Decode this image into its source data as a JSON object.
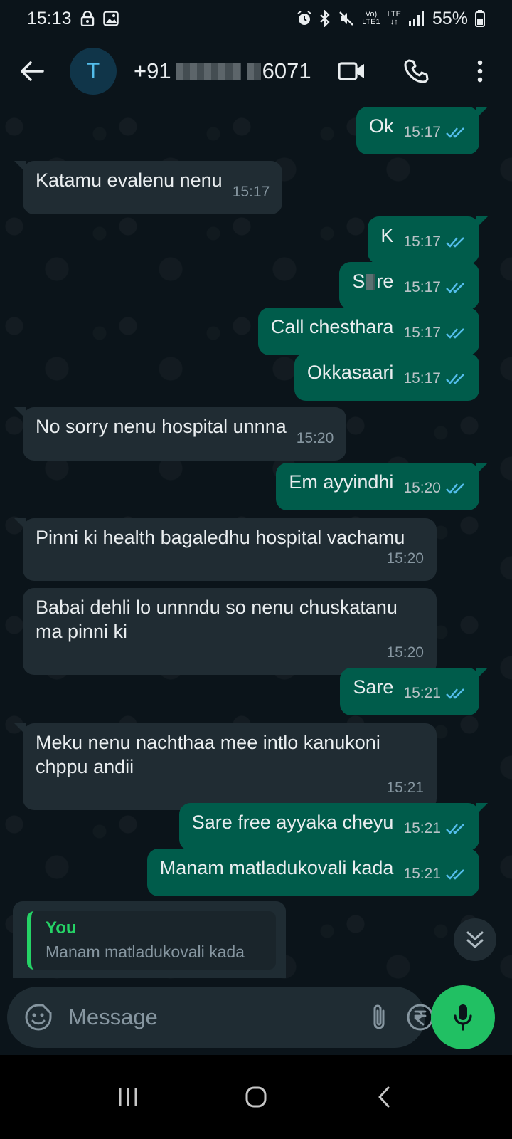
{
  "status_bar": {
    "time": "15:13",
    "network_top": "Vo)",
    "network_bottom": "LTE1",
    "lte_label": "LTE",
    "battery": "55%"
  },
  "header": {
    "avatar_letter": "T",
    "contact_prefix": "+91",
    "contact_suffix": "6071",
    "contact_masked_middle": "",
    "contact_masked_mid2": ""
  },
  "messages": [
    {
      "dir": "out",
      "text": "Ok",
      "time": "15:17",
      "read": true
    },
    {
      "dir": "in",
      "text": "Katamu evalenu nenu",
      "time": "15:17"
    },
    {
      "dir": "out",
      "text": "K",
      "time": "15:17",
      "read": true
    },
    {
      "dir": "out",
      "text_a": "S",
      "text_b": "re",
      "time": "15:17",
      "read": true
    },
    {
      "dir": "out",
      "text": "Call chesthara",
      "time": "15:17",
      "read": true
    },
    {
      "dir": "out",
      "text": "Okkasaari",
      "time": "15:17",
      "read": true
    },
    {
      "dir": "in",
      "text": "No sorry nenu hospital unnna",
      "time": "15:20"
    },
    {
      "dir": "out",
      "text": "Em ayyindhi",
      "time": "15:20",
      "read": true
    },
    {
      "dir": "in",
      "text": "Pinni ki health bagaledhu hospital vachamu",
      "time": "15:20"
    },
    {
      "dir": "in",
      "text": "Babai dehli lo unnndu so nenu chuskatanu ma pinni ki",
      "time": "15:20"
    },
    {
      "dir": "out",
      "text": "Sare",
      "time": "15:21",
      "read": true
    },
    {
      "dir": "in",
      "text": "Meku nenu nachthaa mee intlo kanukoni chppu andii",
      "time": "15:21"
    },
    {
      "dir": "out",
      "text": "Sare free ayyaka cheyu",
      "time": "15:21",
      "read": true
    },
    {
      "dir": "out",
      "text": "Manam matladukovali kada",
      "time": "15:21",
      "read": true
    }
  ],
  "reply_preview": {
    "author": "You",
    "text": "Manam matladukovali kada"
  },
  "composer": {
    "placeholder": "Message"
  },
  "colors": {
    "outgoing_bubble": "#005c4b",
    "incoming_bubble": "#202c33",
    "accent_green": "#21c063",
    "read_tick_blue": "#53bdeb",
    "background": "#0b141a"
  }
}
